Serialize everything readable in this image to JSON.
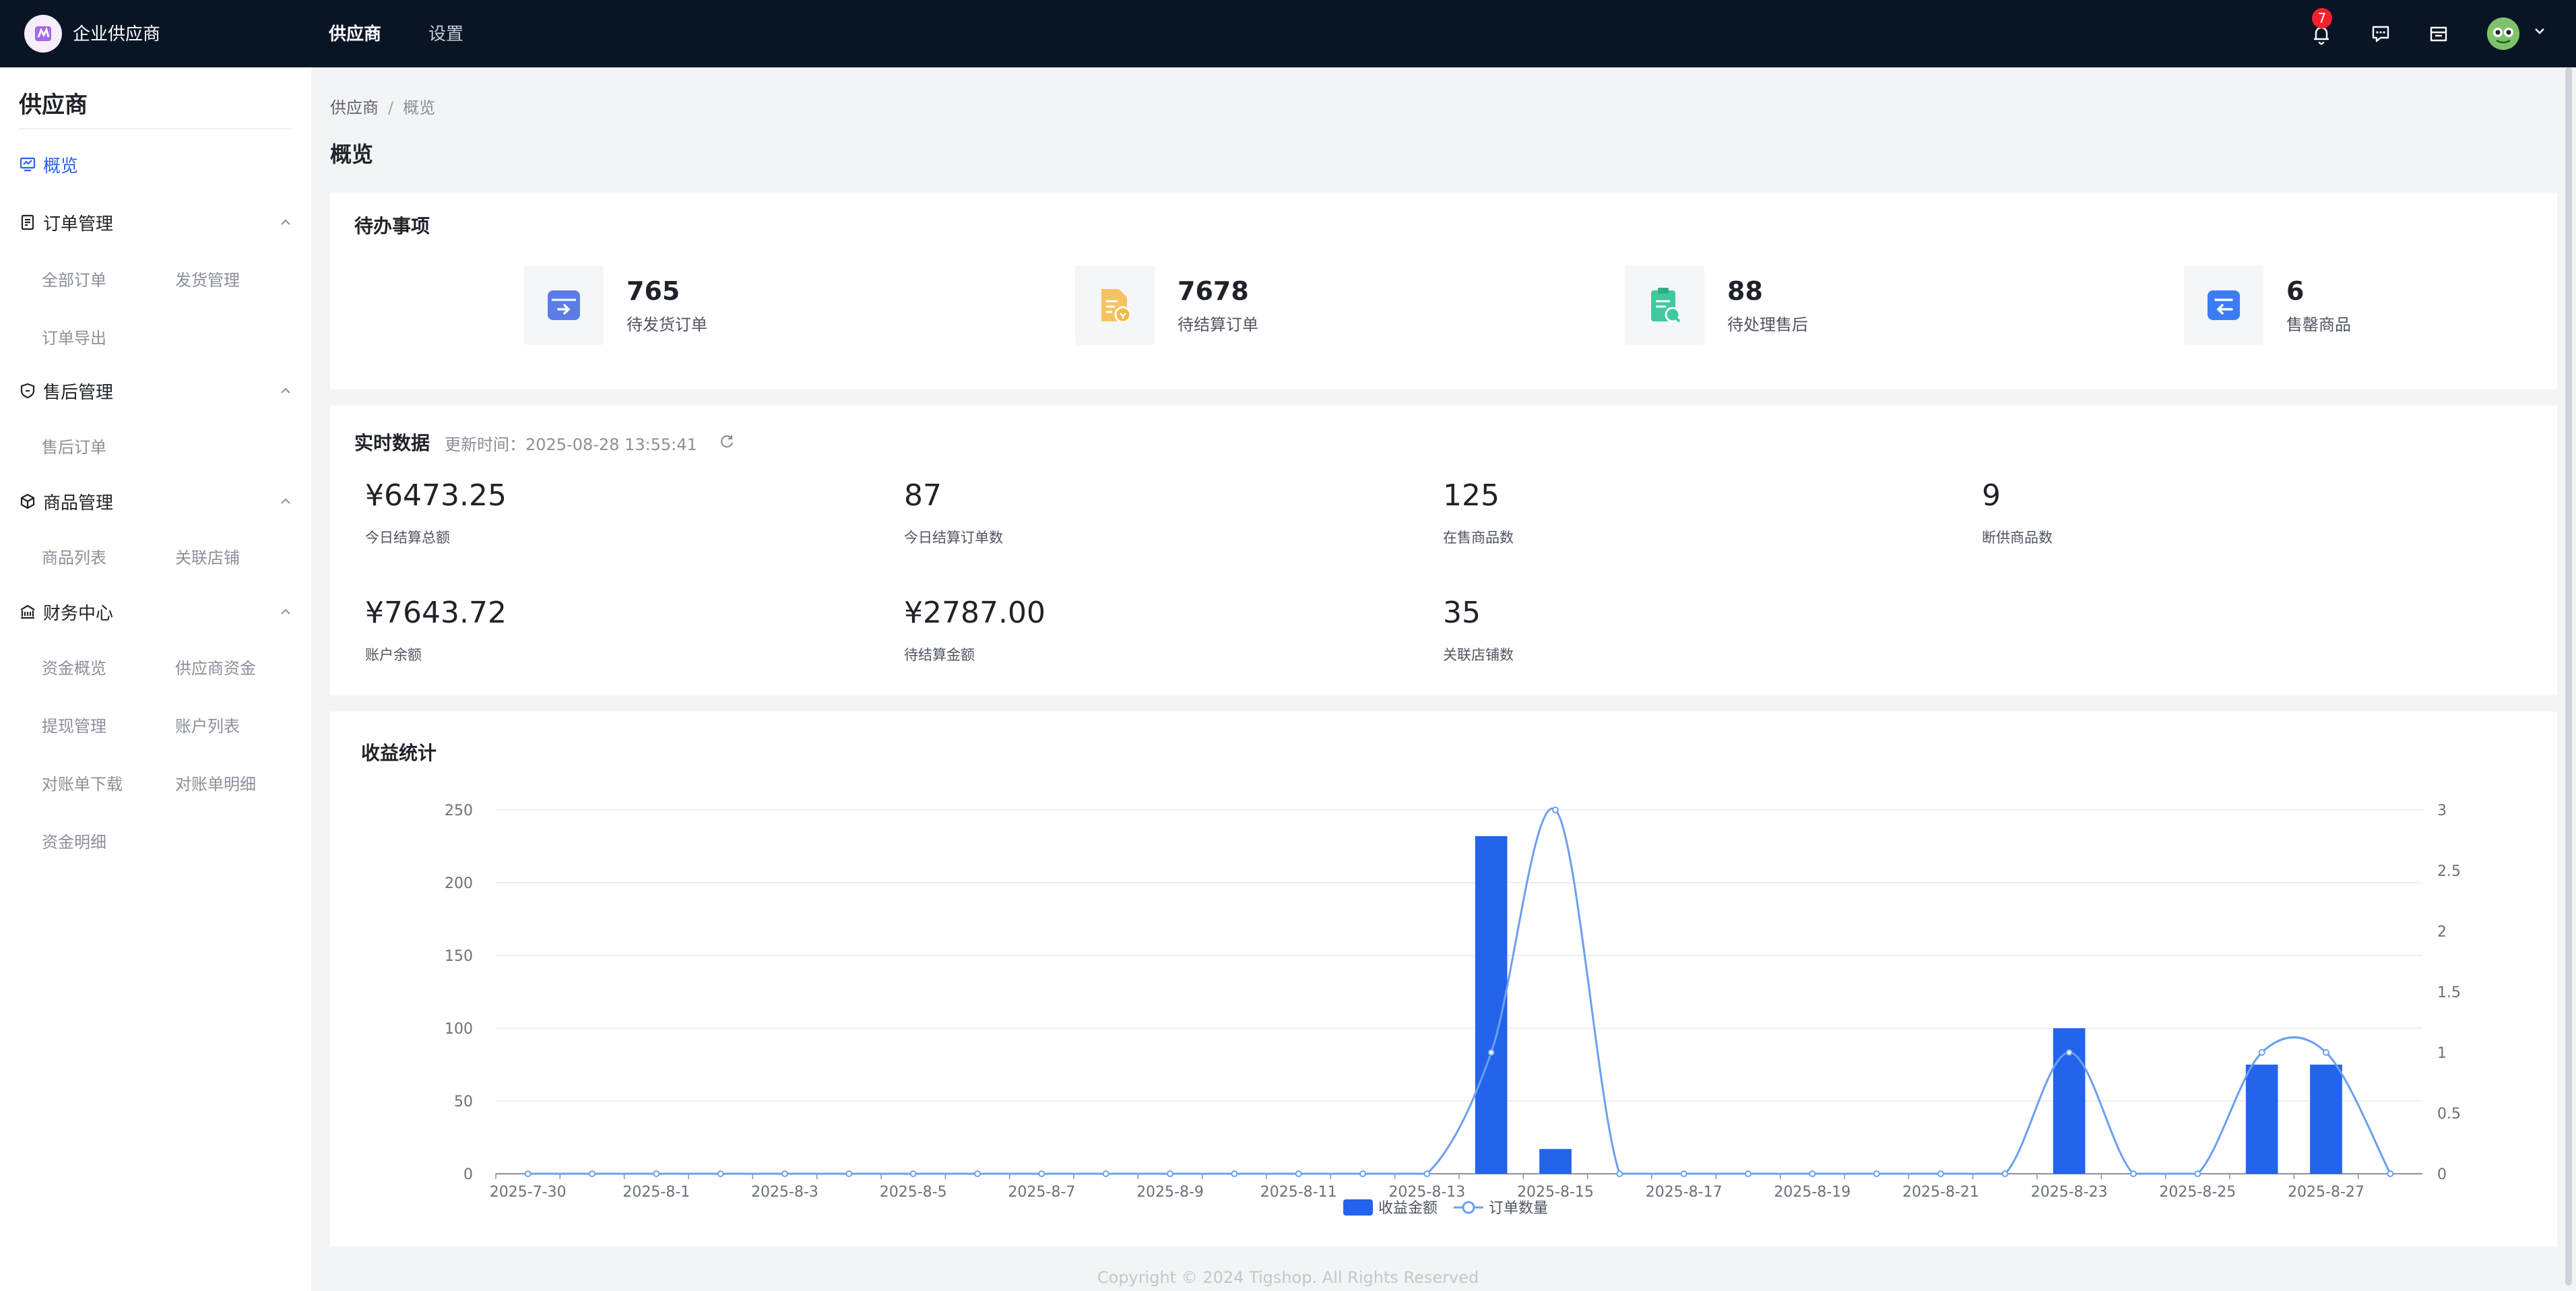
{
  "topbar": {
    "brand": "企业供应商",
    "nav": [
      "供应商",
      "设置"
    ],
    "notification_count": "7",
    "colors": {
      "bg": "#091525",
      "accent": "#2463eb",
      "badge": "#f5222d"
    },
    "icons": [
      "bell-icon",
      "message-icon",
      "store-icon",
      "avatar",
      "chevron-down-icon"
    ]
  },
  "sidebar": {
    "title": "供应商",
    "active_item": "概览",
    "groups": [
      {
        "label": "订单管理",
        "icon": "order-icon",
        "items": [
          "全部订单",
          "发货管理",
          "订单导出"
        ]
      },
      {
        "label": "售后管理",
        "icon": "shield-icon",
        "items": [
          "售后订单"
        ]
      },
      {
        "label": "商品管理",
        "icon": "cube-icon",
        "items": [
          "商品列表",
          "关联店铺"
        ]
      },
      {
        "label": "财务中心",
        "icon": "finance-icon",
        "items": [
          "资金概览",
          "供应商资金",
          "提现管理",
          "账户列表",
          "对账单下载",
          "对账单明细",
          "资金明细"
        ]
      }
    ]
  },
  "breadcrumb": {
    "parent": "供应商",
    "separator": "/",
    "current": "概览"
  },
  "page_title": "概览",
  "todo": {
    "title": "待办事项",
    "items": [
      {
        "value": "765",
        "label": "待发货订单",
        "icon": "shipping-box-icon",
        "color": "#5b7de8"
      },
      {
        "value": "7678",
        "label": "待结算订单",
        "icon": "settlement-doc-icon",
        "color": "#f5b945"
      },
      {
        "value": "88",
        "label": "待处理售后",
        "icon": "aftersale-clipboard-icon",
        "color": "#3fc99d"
      },
      {
        "value": "6",
        "label": "售罄商品",
        "icon": "soldout-product-icon",
        "color": "#3b7cf5"
      }
    ]
  },
  "realtime": {
    "title": "实时数据",
    "updated_prefix": "更新时间：",
    "updated_time": "2025-08-28 13:55:41",
    "stats": [
      {
        "value": "¥6473.25",
        "label": "今日结算总额"
      },
      {
        "value": "87",
        "label": "今日结算订单数"
      },
      {
        "value": "125",
        "label": "在售商品数"
      },
      {
        "value": "9",
        "label": "断供商品数"
      },
      {
        "value": "¥7643.72",
        "label": "账户余额"
      },
      {
        "value": "¥2787.00",
        "label": "待结算金额"
      },
      {
        "value": "35",
        "label": "关联店铺数"
      }
    ]
  },
  "revenue": {
    "title": "收益统计"
  },
  "chart_data": {
    "type": "bar",
    "categories": [
      "2025-7-30",
      "2025-7-31",
      "2025-8-1",
      "2025-8-2",
      "2025-8-3",
      "2025-8-4",
      "2025-8-5",
      "2025-8-6",
      "2025-8-7",
      "2025-8-8",
      "2025-8-9",
      "2025-8-10",
      "2025-8-11",
      "2025-8-12",
      "2025-8-13",
      "2025-8-14",
      "2025-8-15",
      "2025-8-16",
      "2025-8-17",
      "2025-8-18",
      "2025-8-19",
      "2025-8-20",
      "2025-8-21",
      "2025-8-22",
      "2025-8-23",
      "2025-8-24",
      "2025-8-25",
      "2025-8-26",
      "2025-8-27",
      "2025-8-28"
    ],
    "x_tick_labels": [
      "2025-7-30",
      "2025-8-1",
      "2025-8-3",
      "2025-8-5",
      "2025-8-7",
      "2025-8-9",
      "2025-8-11",
      "2025-8-13",
      "2025-8-15",
      "2025-8-17",
      "2025-8-19",
      "2025-8-21",
      "2025-8-23",
      "2025-8-25",
      "2025-8-27"
    ],
    "series": [
      {
        "name": "收益金额",
        "type": "bar",
        "axis": "left",
        "color": "#2463eb",
        "values": [
          0,
          0,
          0,
          0,
          0,
          0,
          0,
          0,
          0,
          0,
          0,
          0,
          0,
          0,
          0,
          232,
          17,
          0,
          0,
          0,
          0,
          0,
          0,
          0,
          100,
          0,
          0,
          75,
          75,
          0
        ]
      },
      {
        "name": "订单数量",
        "type": "line",
        "axis": "right",
        "smooth": true,
        "color": "#6aa0f0",
        "values": [
          0,
          0,
          0,
          0,
          0,
          0,
          0,
          0,
          0,
          0,
          0,
          0,
          0,
          0,
          0,
          1,
          3,
          0,
          0,
          0,
          0,
          0,
          0,
          0,
          1,
          0,
          0,
          1,
          1,
          0
        ]
      }
    ],
    "y_left": {
      "ticks": [
        0,
        50,
        100,
        150,
        200,
        250
      ],
      "lim": [
        0,
        250
      ]
    },
    "y_right": {
      "ticks": [
        "0",
        "0.5",
        "1",
        "1.5",
        "2",
        "2.5",
        "3"
      ],
      "lim": [
        0,
        3
      ]
    },
    "grid": true,
    "legend": "bottom-center"
  },
  "footer": "Copyright © 2024 Tigshop. All Rights Reserved"
}
